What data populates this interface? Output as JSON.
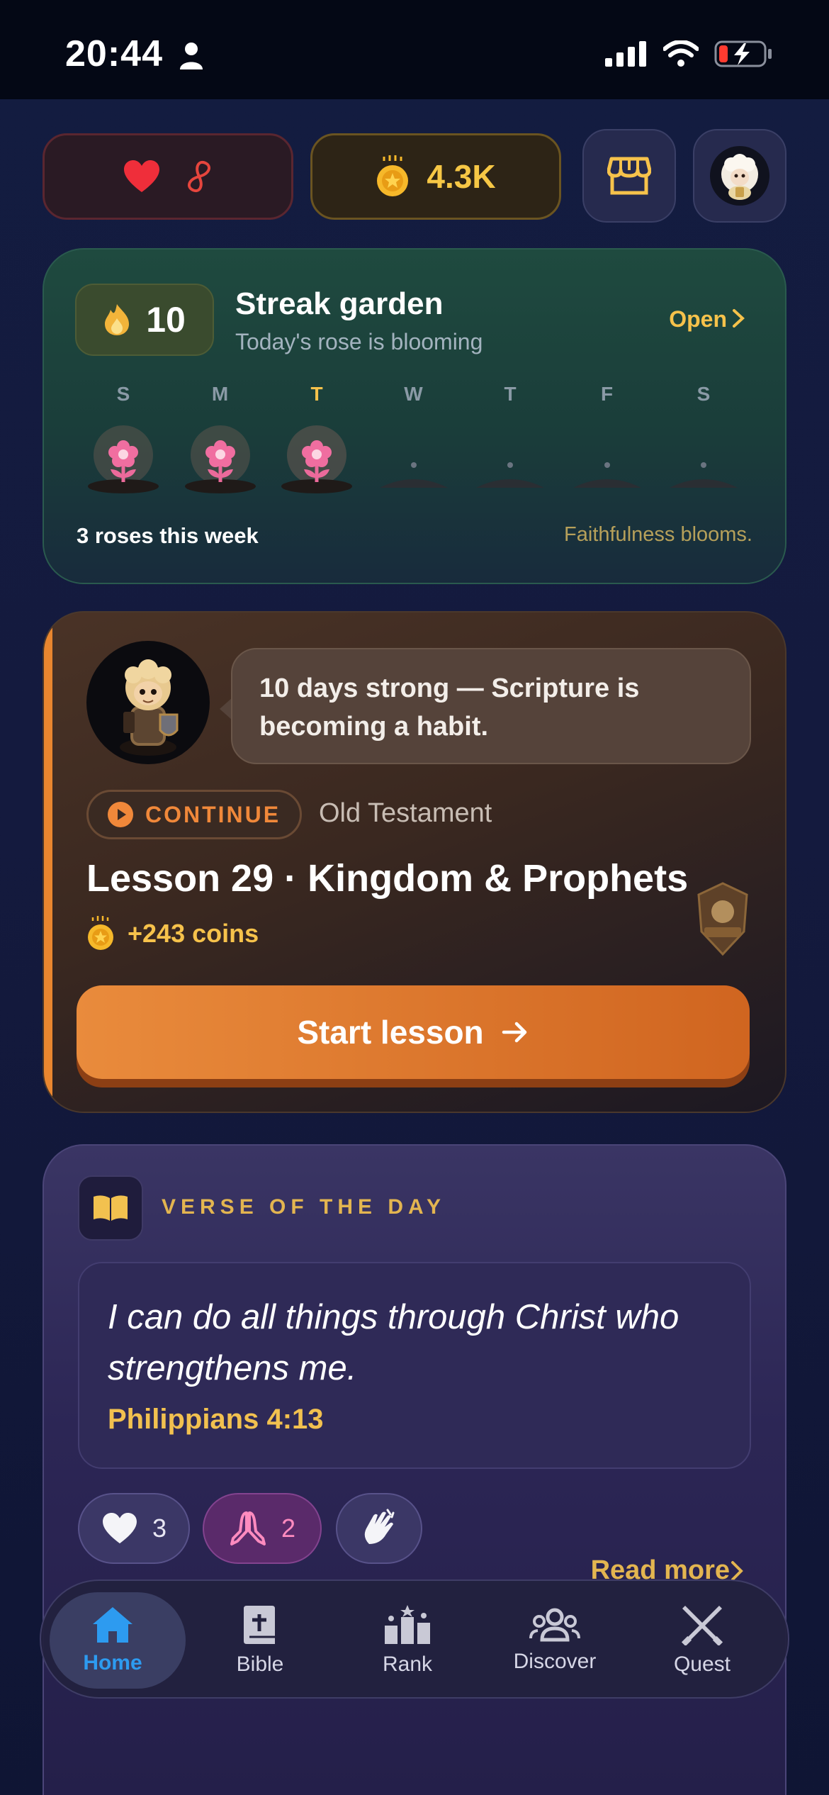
{
  "status_bar": {
    "time": "20:44"
  },
  "top_bar": {
    "coins_value": "4.3K"
  },
  "streak": {
    "count": "10",
    "title": "Streak garden",
    "subtitle": "Today's rose is blooming",
    "open_label": "Open",
    "days": [
      {
        "label": "S",
        "bloomed": true,
        "today": false
      },
      {
        "label": "M",
        "bloomed": true,
        "today": false
      },
      {
        "label": "T",
        "bloomed": true,
        "today": true
      },
      {
        "label": "W",
        "bloomed": false,
        "today": false
      },
      {
        "label": "T",
        "bloomed": false,
        "today": false
      },
      {
        "label": "F",
        "bloomed": false,
        "today": false
      },
      {
        "label": "S",
        "bloomed": false,
        "today": false
      }
    ],
    "week_summary": "3 roses this week",
    "tagline": "Faithfulness blooms."
  },
  "lesson": {
    "message": "10 days strong — Scripture is becoming a habit.",
    "continue_label": "CONTINUE",
    "section": "Old Testament",
    "title": "Lesson 29 · Kingdom & Prophets",
    "reward": "+243 coins",
    "start_label": "Start lesson"
  },
  "verse": {
    "label": "VERSE OF THE DAY",
    "text": "I can do all things through Christ who strengthens me.",
    "reference": "Philippians 4:13",
    "reactions": {
      "hearts": "3",
      "prayers": "2"
    },
    "read_more": "Read more"
  },
  "tabs": [
    {
      "label": "Home",
      "icon": "home-icon",
      "active": true
    },
    {
      "label": "Bible",
      "icon": "bible-icon",
      "active": false
    },
    {
      "label": "Rank",
      "icon": "rank-icon",
      "active": false
    },
    {
      "label": "Discover",
      "icon": "discover-icon",
      "active": false
    },
    {
      "label": "Quest",
      "icon": "quest-icon",
      "active": false
    }
  ],
  "colors": {
    "accent_gold": "#f6c24b",
    "accent_orange": "#e98b3c",
    "active_tab": "#2d9bf0"
  }
}
